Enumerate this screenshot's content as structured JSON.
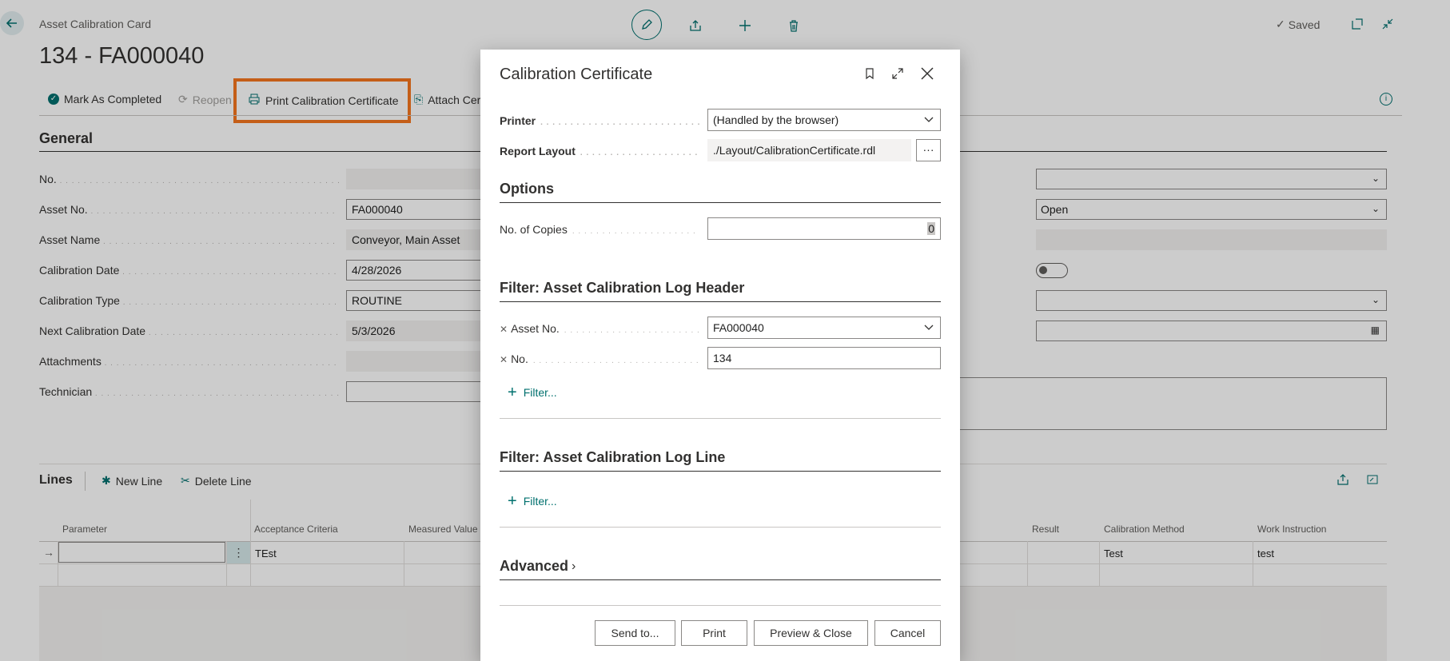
{
  "card": {
    "caption": "Asset Calibration Card",
    "title": "134 - FA000040",
    "saved_label": "Saved"
  },
  "actions": {
    "mark_completed": "Mark As Completed",
    "reopen": "Reopen",
    "print_certificate": "Print Calibration Certificate",
    "attach": "Attach Cer"
  },
  "general": {
    "title": "General",
    "fields": [
      {
        "label": "No.",
        "value": ""
      },
      {
        "label": "Asset No.",
        "value": "FA000040"
      },
      {
        "label": "Asset Name",
        "value": "Conveyor, Main Asset"
      },
      {
        "label": "Calibration Date",
        "value": "4/28/2026"
      },
      {
        "label": "Calibration Type",
        "value": "ROUTINE"
      },
      {
        "label": "Next Calibration Date",
        "value": "5/3/2026"
      },
      {
        "label": "Attachments",
        "value": ""
      },
      {
        "label": "Technician",
        "value": ""
      }
    ],
    "right_status": "Open"
  },
  "lines": {
    "title": "Lines",
    "new_line": "New Line",
    "delete_line": "Delete Line",
    "columns": [
      "Parameter",
      "Acceptance Criteria",
      "Measured Value (",
      "Result",
      "Calibration Method",
      "Work Instruction"
    ],
    "row": {
      "parameter": "",
      "acceptance": "TEst",
      "method": "Test",
      "instruction": "test"
    }
  },
  "dialog": {
    "title": "Calibration Certificate",
    "printer_label": "Printer",
    "printer_value": "(Handled by the browser)",
    "layout_label": "Report Layout",
    "layout_value": "./Layout/CalibrationCertificate.rdl",
    "layout_btn": "···",
    "options_title": "Options",
    "copies_label": "No. of Copies",
    "copies_value": "0",
    "filter_header_title": "Filter: Asset Calibration Log Header",
    "filter_asset_label": "Asset No.",
    "filter_asset_value": "FA000040",
    "filter_no_label": "No.",
    "filter_no_value": "134",
    "filter_link": "Filter...",
    "filter_line_title": "Filter: Asset Calibration Log Line",
    "advanced": "Advanced",
    "buttons": {
      "send": "Send to...",
      "print": "Print",
      "preview": "Preview & Close",
      "cancel": "Cancel"
    }
  }
}
